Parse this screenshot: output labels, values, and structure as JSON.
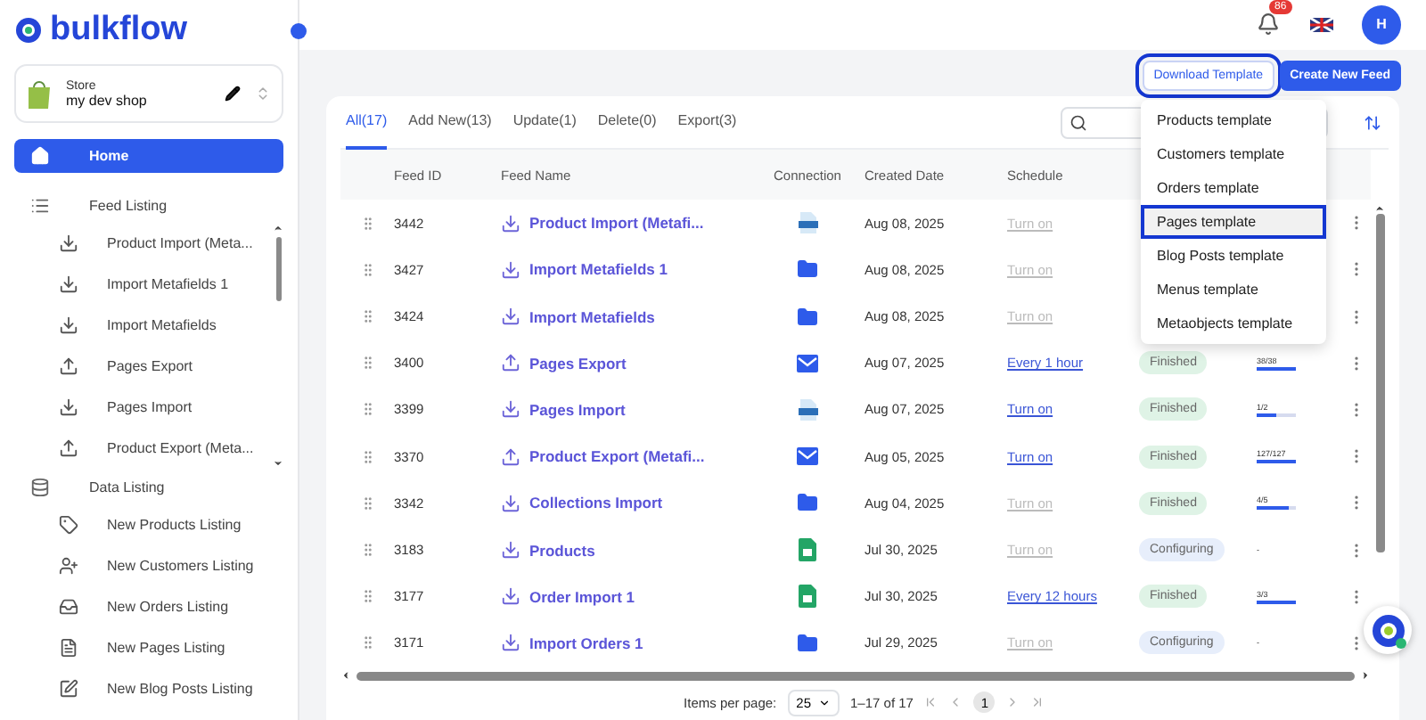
{
  "brand": {
    "name": "bulkflow"
  },
  "store": {
    "label": "Store",
    "name": "my dev shop"
  },
  "sidebar": {
    "items": [
      {
        "label": "Home",
        "selected": true
      }
    ],
    "sections": [
      {
        "label": "Feed Listing",
        "kind": "feeds",
        "children": [
          {
            "label": "Product Import (Meta...",
            "kind": "import"
          },
          {
            "label": "Import Metafields 1",
            "kind": "import"
          },
          {
            "label": "Import Metafields",
            "kind": "import"
          },
          {
            "label": "Pages Export",
            "kind": "export"
          },
          {
            "label": "Pages Import",
            "kind": "import"
          },
          {
            "label": "Product Export (Meta...",
            "kind": "export"
          }
        ]
      },
      {
        "label": "Data Listing",
        "kind": "data",
        "children": [
          {
            "label": "New Products Listing",
            "kind": "products"
          },
          {
            "label": "New Customers Listing",
            "kind": "customers"
          },
          {
            "label": "New Orders Listing",
            "kind": "orders"
          },
          {
            "label": "New Pages Listing",
            "kind": "pages"
          },
          {
            "label": "New Blog Posts Listing",
            "kind": "posts"
          }
        ]
      }
    ]
  },
  "header": {
    "notifications": "86",
    "avatar": "H"
  },
  "actions": [
    {
      "label": "Download Template",
      "kind": "outline",
      "focused": true
    },
    {
      "label": "Create New Feed",
      "kind": "primary",
      "focused": false
    }
  ],
  "template_menu": {
    "items": [
      {
        "label": "Products template",
        "selected": false
      },
      {
        "label": "Customers template",
        "selected": false
      },
      {
        "label": "Orders template",
        "selected": false
      },
      {
        "label": "Pages template",
        "selected": true
      },
      {
        "label": "Blog Posts template",
        "selected": false
      },
      {
        "label": "Menus template",
        "selected": false
      },
      {
        "label": "Metaobjects template",
        "selected": false
      }
    ]
  },
  "tabs": [
    {
      "label": "All(17)",
      "selected": true
    },
    {
      "label": "Add New(13)",
      "selected": false
    },
    {
      "label": "Update(1)",
      "selected": false
    },
    {
      "label": "Delete(0)",
      "selected": false
    },
    {
      "label": "Export(3)",
      "selected": false
    }
  ],
  "table": {
    "columns": [
      "Feed ID",
      "Feed Name",
      "Connection",
      "Created Date",
      "Schedule"
    ],
    "rows": [
      {
        "id": "3442",
        "name": "Product Import (Metafi...",
        "kind": "import",
        "connection": {
          "kind": "url"
        },
        "date": "Aug 08, 2025",
        "schedule": "Turn on",
        "schedule_active": false
      },
      {
        "id": "3427",
        "name": "Import Metafields 1",
        "kind": "import",
        "connection": {
          "kind": "folder"
        },
        "date": "Aug 08, 2025",
        "schedule": "Turn on",
        "schedule_active": false
      },
      {
        "id": "3424",
        "name": "Import Metafields",
        "kind": "import",
        "connection": {
          "kind": "folder"
        },
        "date": "Aug 08, 2025",
        "schedule": "Turn on",
        "schedule_active": false
      },
      {
        "id": "3400",
        "name": "Pages Export",
        "kind": "export",
        "connection": {
          "kind": "email"
        },
        "date": "Aug 07, 2025",
        "schedule": "Every 1 hour",
        "schedule_active": true,
        "status": "Finished",
        "progress": "38/38",
        "level": 1
      },
      {
        "id": "3399",
        "name": "Pages Import",
        "kind": "import",
        "connection": {
          "kind": "url"
        },
        "date": "Aug 07, 2025",
        "schedule": "Turn on",
        "schedule_active": true,
        "status": "Finished",
        "progress": "1/2",
        "level": 0.5
      },
      {
        "id": "3370",
        "name": "Product Export (Metafi...",
        "kind": "export",
        "connection": {
          "kind": "email"
        },
        "date": "Aug 05, 2025",
        "schedule": "Turn on",
        "schedule_active": true,
        "status": "Finished",
        "progress": "127/127",
        "level": 1
      },
      {
        "id": "3342",
        "name": "Collections Import",
        "kind": "import",
        "connection": {
          "kind": "folder"
        },
        "date": "Aug 04, 2025",
        "schedule": "Turn on",
        "schedule_active": false,
        "status": "Finished",
        "progress": "4/5",
        "level": 0.8
      },
      {
        "id": "3183",
        "name": "Products",
        "kind": "import",
        "connection": {
          "kind": "sheet"
        },
        "date": "Jul 30, 2025",
        "schedule": "Turn on",
        "schedule_active": false,
        "status": "Configuring",
        "progress": "-"
      },
      {
        "id": "3177",
        "name": "Order Import 1",
        "kind": "import",
        "connection": {
          "kind": "sheet"
        },
        "date": "Jul 30, 2025",
        "schedule": "Every 12 hours",
        "schedule_active": true,
        "status": "Finished",
        "progress": "3/3",
        "level": 1
      },
      {
        "id": "3171",
        "name": "Import Orders 1",
        "kind": "import",
        "connection": {
          "kind": "folder"
        },
        "date": "Jul 29, 2025",
        "schedule": "Turn on",
        "schedule_active": false,
        "status": "Configuring",
        "progress": "-"
      }
    ]
  },
  "pagination": {
    "items_per_page_label": "Items per page:",
    "page_size": "25",
    "range": "1–17 of 17",
    "pages": [
      {
        "label": "1",
        "selected": true
      }
    ]
  }
}
